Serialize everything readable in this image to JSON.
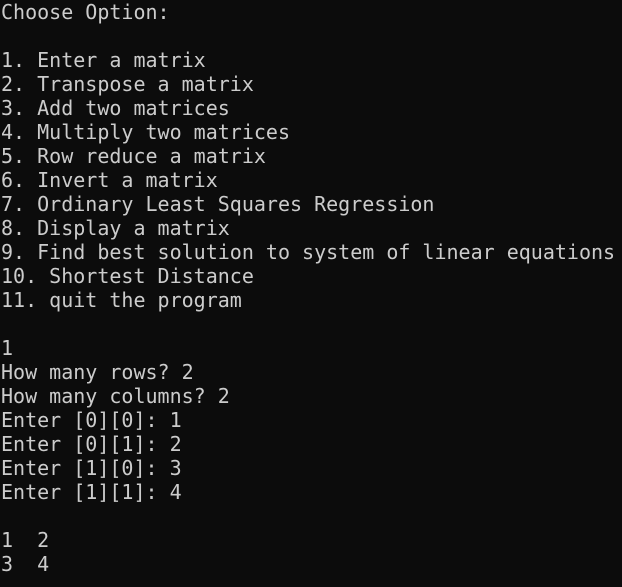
{
  "terminal": {
    "prompt_title": "Choose Option:",
    "menu": [
      "1. Enter a matrix",
      "2. Transpose a matrix",
      "3. Add two matrices",
      "4. Multiply two matrices",
      "5. Row reduce a matrix",
      "6. Invert a matrix",
      "7. Ordinary Least Squares Regression",
      "8. Display a matrix",
      "9. Find best solution to system of linear equations",
      "10. Shortest Distance",
      "11. quit the program"
    ],
    "user_choice": "1",
    "session": [
      "How many rows? 2",
      "How many columns? 2",
      "Enter [0][0]: 1",
      "Enter [0][1]: 2",
      "Enter [1][0]: 3",
      "Enter [1][1]: 4"
    ],
    "matrix_output": [
      "1  2",
      "3  4"
    ],
    "colors": {
      "background": "#0c0c0c",
      "foreground": "#cccccc"
    }
  }
}
